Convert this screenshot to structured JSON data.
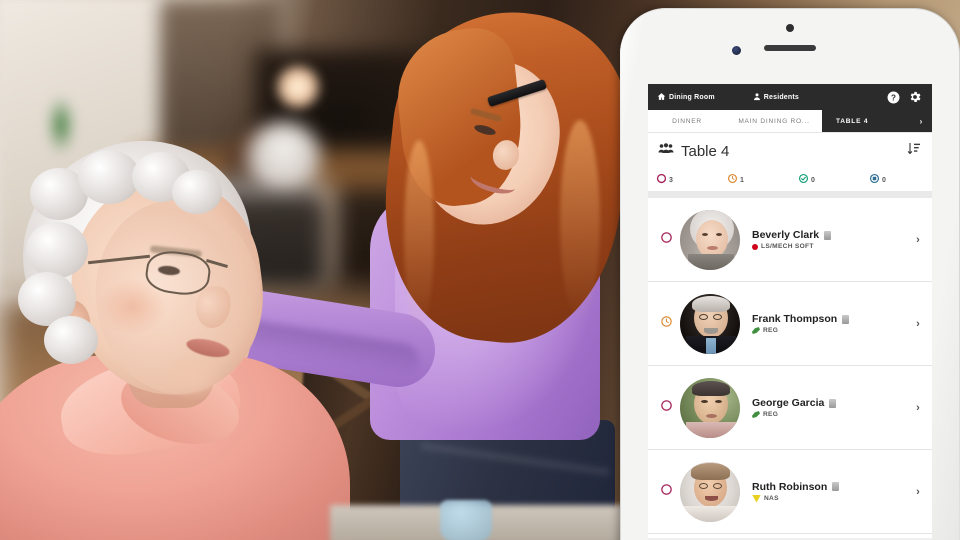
{
  "app": {
    "navbar": {
      "home_icon": "home-icon",
      "home_label": "Dining Room",
      "residents_icon": "user-icon",
      "residents_label": "Residents",
      "help_icon": "help-circle-icon",
      "settings_icon": "gear-icon"
    },
    "breadcrumbs": [
      {
        "label": "DINNER",
        "active": false
      },
      {
        "label": "MAIN DINING RO...",
        "active": false
      },
      {
        "label": "TABLE 4",
        "active": true,
        "chevron": "›"
      }
    ],
    "title": {
      "group_icon": "people-group-icon",
      "text": "Table 4",
      "sort_icon": "sort-descending-icon"
    },
    "counters": [
      {
        "icon": "circle-open-icon",
        "count": "3",
        "color": "#a8255c"
      },
      {
        "icon": "clock-icon",
        "count": "1",
        "color": "#e08a33"
      },
      {
        "icon": "check-circle-icon",
        "count": "0",
        "color": "#13a07a"
      },
      {
        "icon": "served-circle-icon",
        "count": "0",
        "color": "#2f6f93"
      }
    ],
    "residents": [
      {
        "status_icon": "circle-open-icon",
        "status_color": "#a8255c",
        "name": "Beverly Clark",
        "name_badge": "id-badge-icon",
        "diet_icon": "red-dot-icon",
        "diet": "LS/MECH SOFT",
        "chevron": "›"
      },
      {
        "status_icon": "clock-icon",
        "status_color": "#e08a33",
        "name": "Frank Thompson",
        "name_badge": "id-badge-icon",
        "diet_icon": "green-leaf-icon",
        "diet": "REG",
        "chevron": "›"
      },
      {
        "status_icon": "circle-open-icon",
        "status_color": "#a8255c",
        "name": "George Garcia",
        "name_badge": "id-badge-icon",
        "diet_icon": "green-leaf-icon",
        "diet": "REG",
        "chevron": "›"
      },
      {
        "status_icon": "circle-open-icon",
        "status_color": "#a8255c",
        "name": "Ruth Robinson",
        "name_badge": "id-badge-icon",
        "diet_icon": "yellow-triangle-icon",
        "diet": "NAS",
        "chevron": "›"
      }
    ],
    "colors": {
      "navbar_bg": "#2b2b2b",
      "active_tab_bg": "#2b2b2b",
      "screen_bg": "#ffffff",
      "phone_body": "#f4f4f2"
    }
  }
}
